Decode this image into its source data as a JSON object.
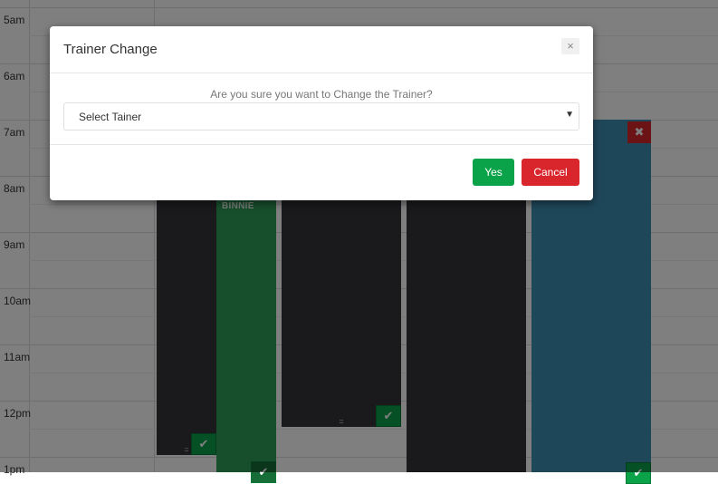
{
  "calendar": {
    "times": [
      "5am",
      "6am",
      "7am",
      "8am",
      "9am",
      "10am",
      "11am",
      "12pm",
      "1pm"
    ],
    "events": [
      {
        "trainer": "BINNIE"
      }
    ]
  },
  "icons": {
    "check": "check-icon",
    "close": "close-icon",
    "grip": "grip-icon"
  },
  "modal": {
    "title": "Trainer Change",
    "close_glyph": "×",
    "question": "Are you sure you want to Change the Trainer?",
    "select": {
      "selected": "Select Tainer"
    },
    "yes_label": "Yes",
    "cancel_label": "Cancel"
  },
  "colors": {
    "event_dark": "#35353b",
    "event_green": "#2f9c59",
    "event_blue": "#3f8fb4",
    "btn_green": "#0ba34a",
    "btn_red": "#d9262c"
  }
}
